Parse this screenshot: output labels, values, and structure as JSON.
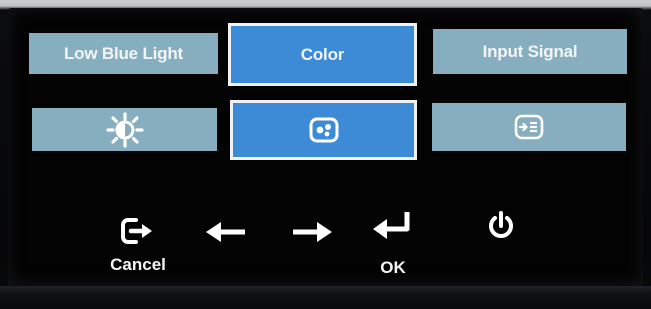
{
  "osd": {
    "menu_tabs": [
      {
        "label": "Low Blue Light",
        "state": "normal"
      },
      {
        "label": "Color",
        "state": "selected"
      },
      {
        "label": "Input Signal",
        "state": "normal"
      }
    ],
    "icon_tiles": [
      {
        "icon": "brightness-icon",
        "state": "normal"
      },
      {
        "icon": "color-palette-icon",
        "state": "selected"
      },
      {
        "icon": "input-source-icon",
        "state": "normal"
      }
    ],
    "controls": {
      "cancel": {
        "icon": "exit-icon",
        "label": "Cancel"
      },
      "left": {
        "icon": "arrow-left-icon"
      },
      "right": {
        "icon": "arrow-right-icon"
      },
      "ok": {
        "icon": "enter-icon",
        "label": "OK"
      },
      "power": {
        "icon": "power-icon"
      }
    }
  },
  "colors": {
    "tile_normal": "#87aebf",
    "tile_selected": "#3d8ad6",
    "selected_border": "#eef2f5",
    "tile_text": "#f2f5f7",
    "background": "#030303"
  }
}
